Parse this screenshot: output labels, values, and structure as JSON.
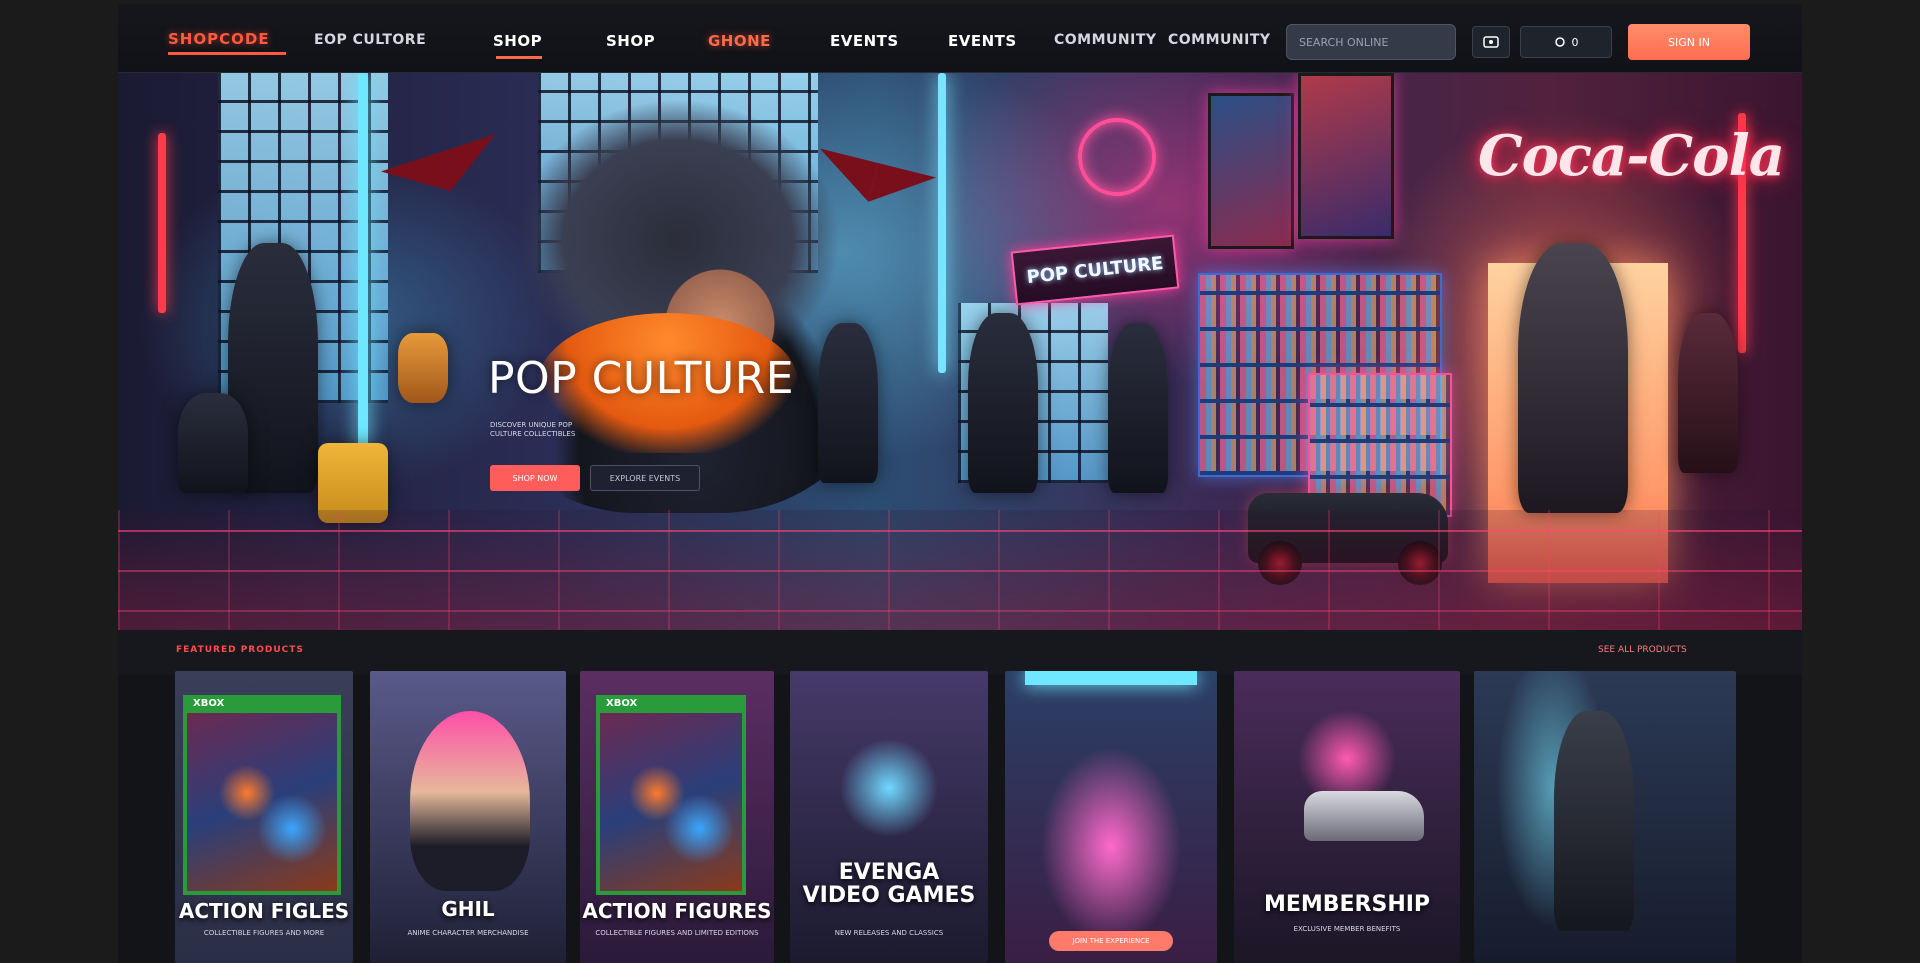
{
  "nav": {
    "logo": "SHOPCODE",
    "links": [
      "EOP CULTORE",
      "SHOP",
      "SHOP",
      "GHONE",
      "EVENTS",
      "EVENTS",
      "COMMUNITY",
      "COMMUNITY"
    ],
    "search_placeholder": "SEARCH ONLINE",
    "icon_button_label": "0",
    "signin_label": "SIGN IN"
  },
  "hero": {
    "title": "POP CULTURE",
    "subtitle": "DISCOVER UNIQUE POP CULTURE COLLECTIBLES",
    "cta_primary": "SHOP NOW",
    "cta_secondary": "EXPLORE EVENTS",
    "store_sign": "POP CULTURE",
    "brand_sign": "Coca-Cola"
  },
  "section": {
    "label": "FEATURED PRODUCTS",
    "link": "SEE ALL PRODUCTS"
  },
  "cards": [
    {
      "label": "ACTION FIGLES",
      "caption": "COLLECTIBLE FIGURES AND MORE",
      "box_tag": "XBOX"
    },
    {
      "label": "GHIL",
      "caption": "ANIME CHARACTER MERCHANDISE"
    },
    {
      "label": "ACTION FIGURES",
      "caption": "COLLECTIBLE FIGURES AND LIMITED EDITIONS",
      "box_tag": "XBOX"
    },
    {
      "label": "EVENGA VIDEO GAMES",
      "caption": "NEW RELEASES AND CLASSICS"
    },
    {
      "label": "",
      "caption": "",
      "pill": "JOIN THE EXPERIENCE"
    },
    {
      "label": "MEMBERSHIP",
      "caption": "EXCLUSIVE MEMBER BENEFITS"
    },
    {
      "label": "",
      "caption": ""
    }
  ],
  "colors": {
    "accent": "#ff6a48",
    "sign_in": "#ff7e5e",
    "neon_pink": "#ff4f9a",
    "neon_cyan": "#7fdcff"
  }
}
